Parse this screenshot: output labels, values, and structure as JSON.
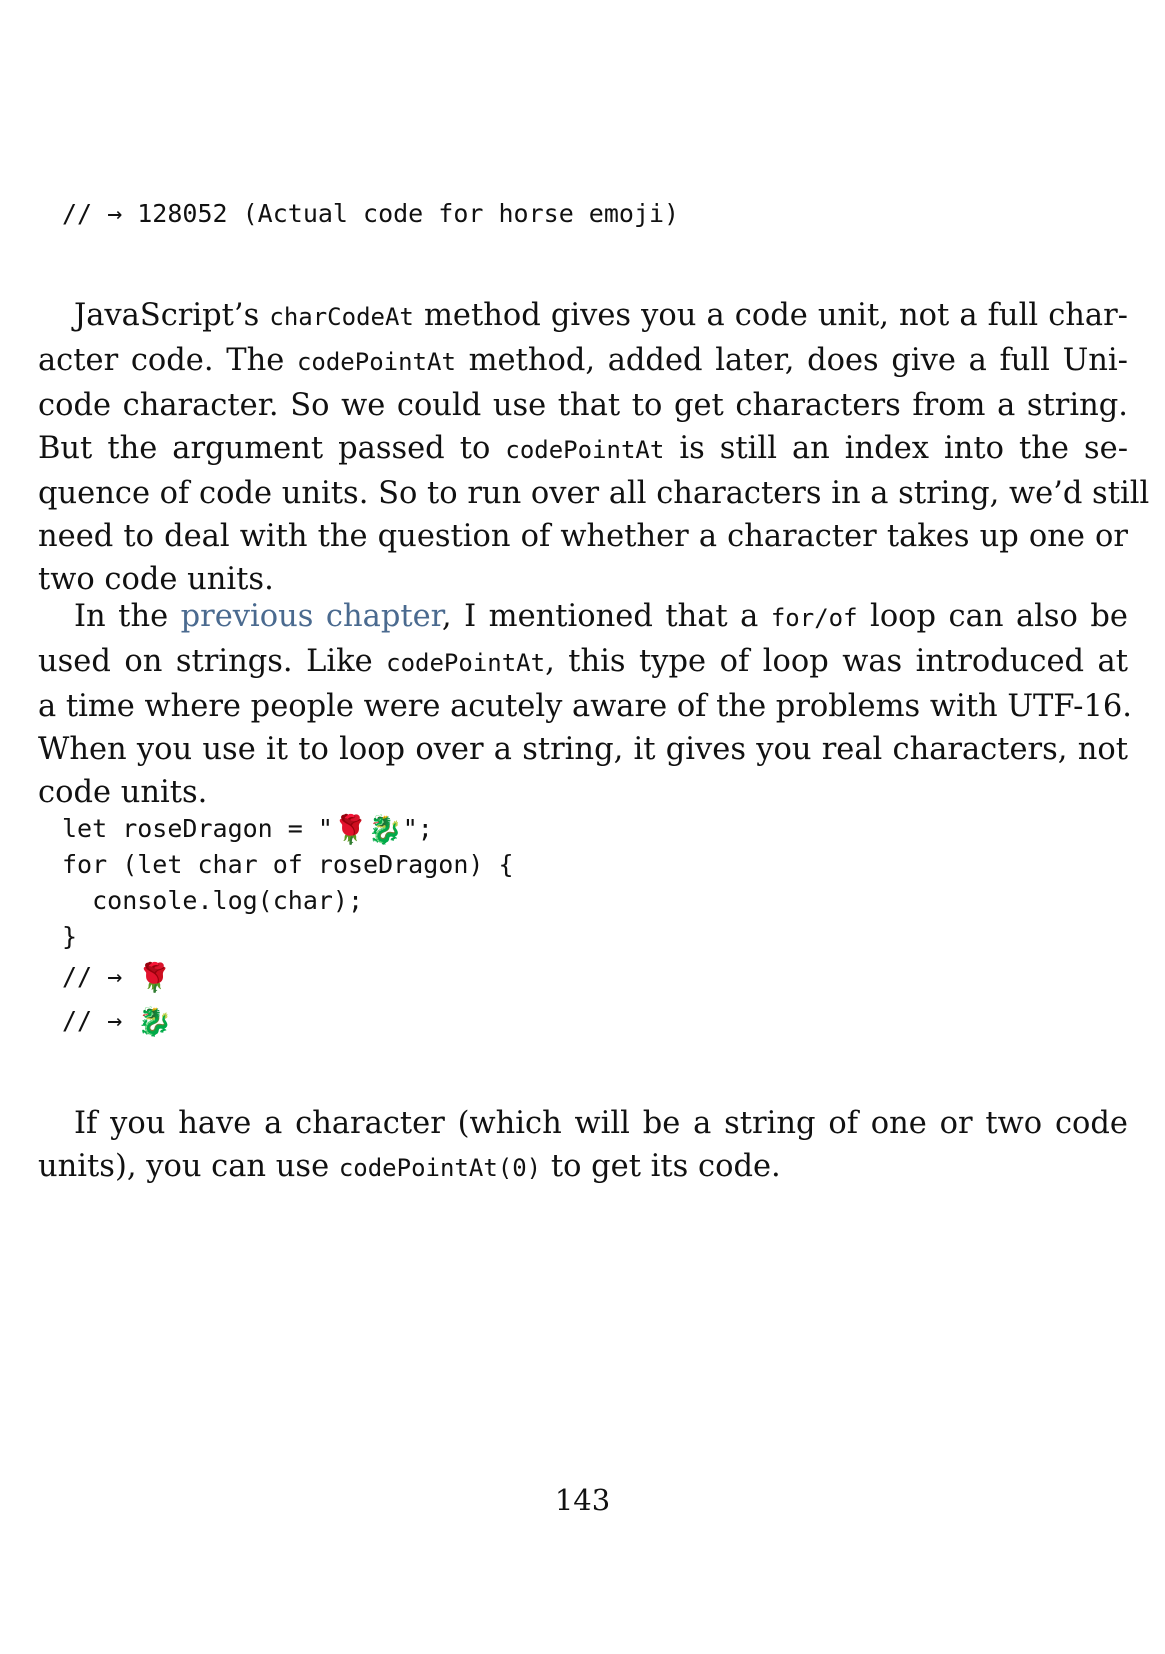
{
  "top_code": {
    "output_line": "// → 128052 (Actual code for horse emoji)"
  },
  "paragraph1": {
    "lines": [
      [
        "JavaScript’s ",
        "charCodeAt",
        " method gives you a code unit, not a full char-"
      ],
      [
        "acter code. The ",
        "codePointAt",
        " method, added later, does give a full Uni-"
      ],
      [
        "code character. So we could use that to get characters from a string."
      ],
      [
        "But the argument passed to ",
        "codePointAt",
        " is still an index into the se-"
      ],
      [
        "quence of code units. So to run over all characters in a string, we’d still"
      ],
      [
        "need to deal with the question of whether a character takes up one or"
      ],
      [
        "two code units."
      ]
    ]
  },
  "paragraph2": {
    "l1_a": "In the ",
    "l1_link": "previous chapter",
    "l1_b": ", I mentioned that a ",
    "l1_code": "for/of",
    "l1_c": " loop can also be",
    "l2_a": "used on strings. Like ",
    "l2_code": "codePointAt",
    "l2_b": ", this type of loop was introduced at",
    "l3": "a time where people were acutely aware of the problems with UTF-16.",
    "l4": "When you use it to loop over a string, it gives you real characters, not",
    "l5": "code units."
  },
  "code_block": {
    "line1_prefix": "let roseDragon = \"",
    "rose": "🌹",
    "dragon": "🐉",
    "line1_suffix": "\";",
    "line2": "for (let char of roseDragon) {",
    "line3": "  console.log(char);",
    "line4": "}",
    "output_prefix": "// → "
  },
  "paragraph3": {
    "l1": "If you have a character (which will be a string of one or two code",
    "l2_a": "units), you can use ",
    "l2_code": "codePointAt(0)",
    "l2_b": " to get its code."
  },
  "page_number": "143"
}
